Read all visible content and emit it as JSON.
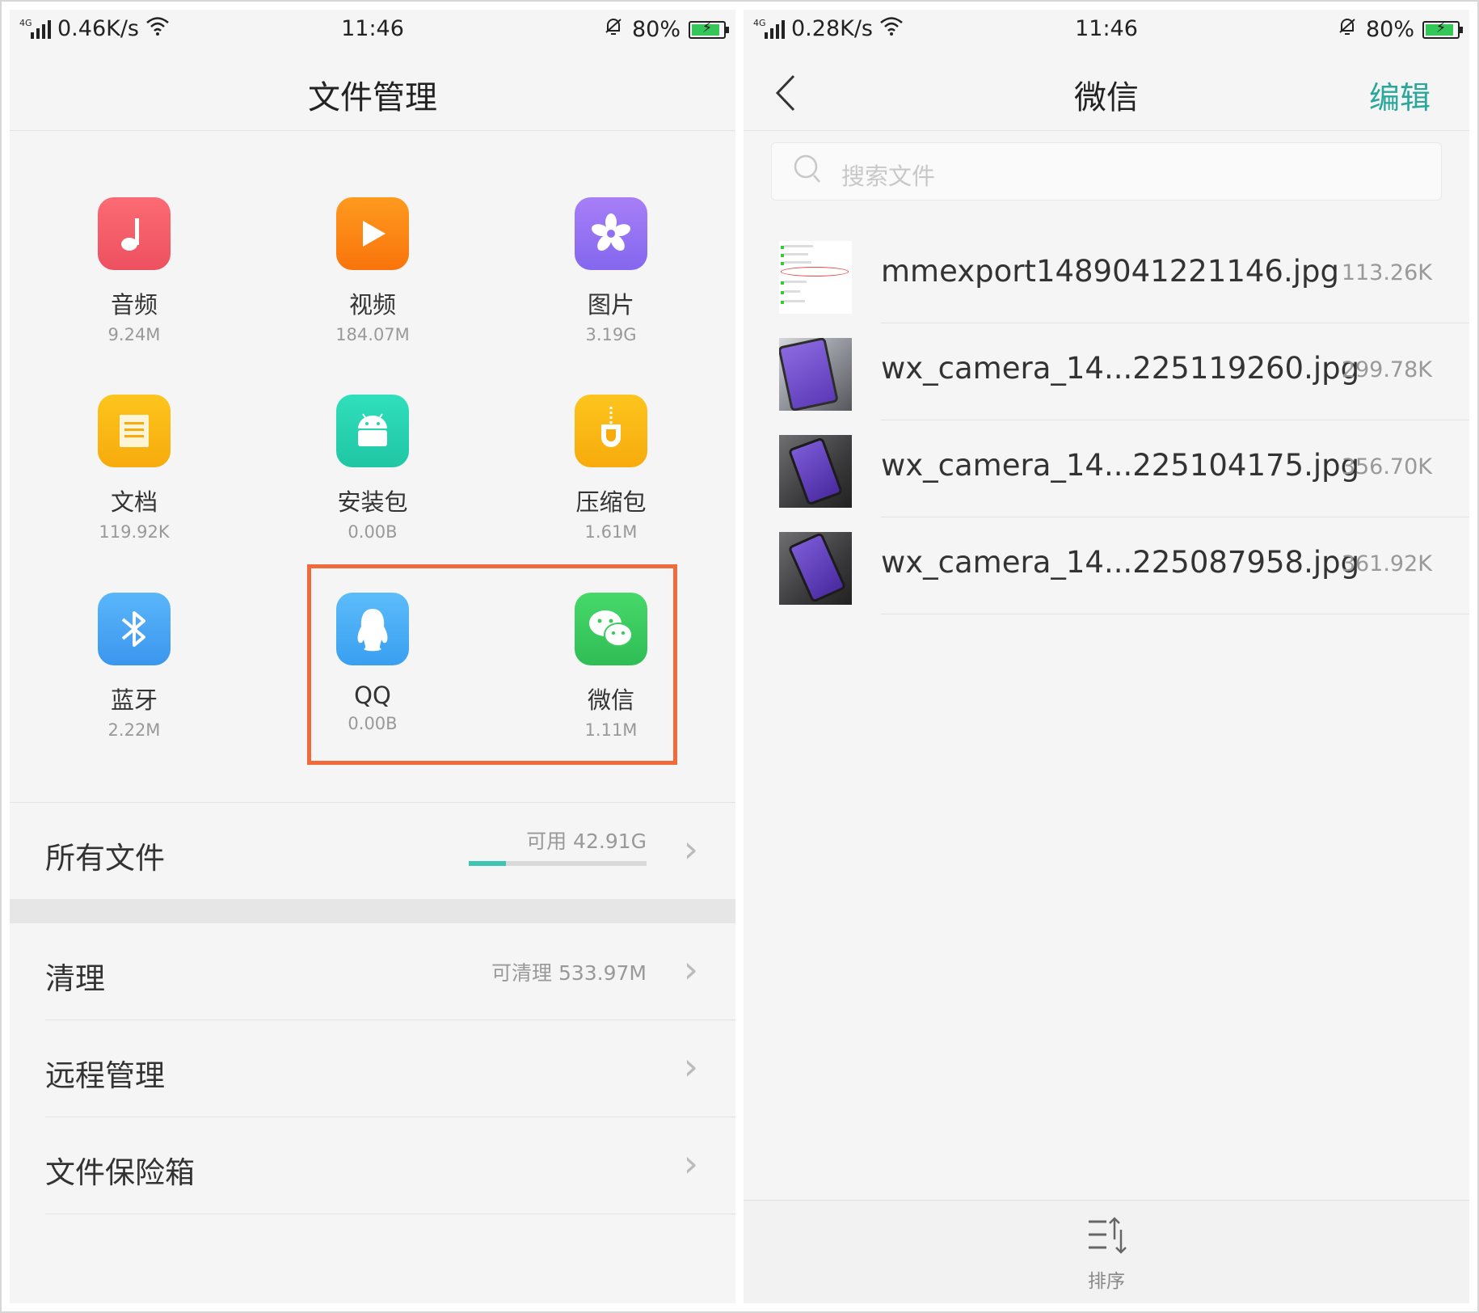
{
  "left": {
    "status": {
      "network_tag": "4G",
      "speed": "0.46K/s",
      "time": "11:46",
      "battery_pct": "80%",
      "battery_level": 0.8
    },
    "title": "文件管理",
    "categories": [
      {
        "label": "音频",
        "size": "9.24M",
        "icon": "music-note-icon",
        "color": "#f25c65"
      },
      {
        "label": "视频",
        "size": "184.07M",
        "icon": "play-icon",
        "color": "#fb7d12"
      },
      {
        "label": "图片",
        "size": "3.19G",
        "icon": "flower-icon",
        "color": "#9170f2"
      },
      {
        "label": "文档",
        "size": "119.92K",
        "icon": "document-icon",
        "color": "#f9b812"
      },
      {
        "label": "安装包",
        "size": "0.00B",
        "icon": "android-icon",
        "color": "#28d3b0"
      },
      {
        "label": "压缩包",
        "size": "1.61M",
        "icon": "zip-icon",
        "color": "#f9b812"
      },
      {
        "label": "蓝牙",
        "size": "2.22M",
        "icon": "bluetooth-icon",
        "color": "#4ba7f4"
      },
      {
        "label": "QQ",
        "size": "0.00B",
        "icon": "qq-penguin-icon",
        "color": "#4aaef5"
      },
      {
        "label": "微信",
        "size": "1.11M",
        "icon": "wechat-icon",
        "color": "#3dcb61"
      }
    ],
    "all_files": {
      "label": "所有文件",
      "available": "可用 42.91G",
      "used_fraction": 0.21
    },
    "menu": [
      {
        "label": "清理",
        "value": "可清理 533.97M"
      },
      {
        "label": "远程管理",
        "value": ""
      },
      {
        "label": "文件保险箱",
        "value": ""
      }
    ]
  },
  "right": {
    "status": {
      "network_tag": "4G",
      "speed": "0.28K/s",
      "time": "11:46",
      "battery_pct": "80%",
      "battery_level": 0.8
    },
    "title": "微信",
    "edit_label": "编辑",
    "search_placeholder": "搜索文件",
    "files": [
      {
        "name": "mmexport1489041221146.jpg",
        "size": "113.26K",
        "thumb": "screenshot"
      },
      {
        "name": "wx_camera_14...225119260.jpg",
        "size": "299.78K",
        "thumb": "photo"
      },
      {
        "name": "wx_camera_14...225104175.jpg",
        "size": "356.70K",
        "thumb": "photo"
      },
      {
        "name": "wx_camera_14...225087958.jpg",
        "size": "361.92K",
        "thumb": "photo"
      }
    ],
    "sort_label": "排序"
  }
}
